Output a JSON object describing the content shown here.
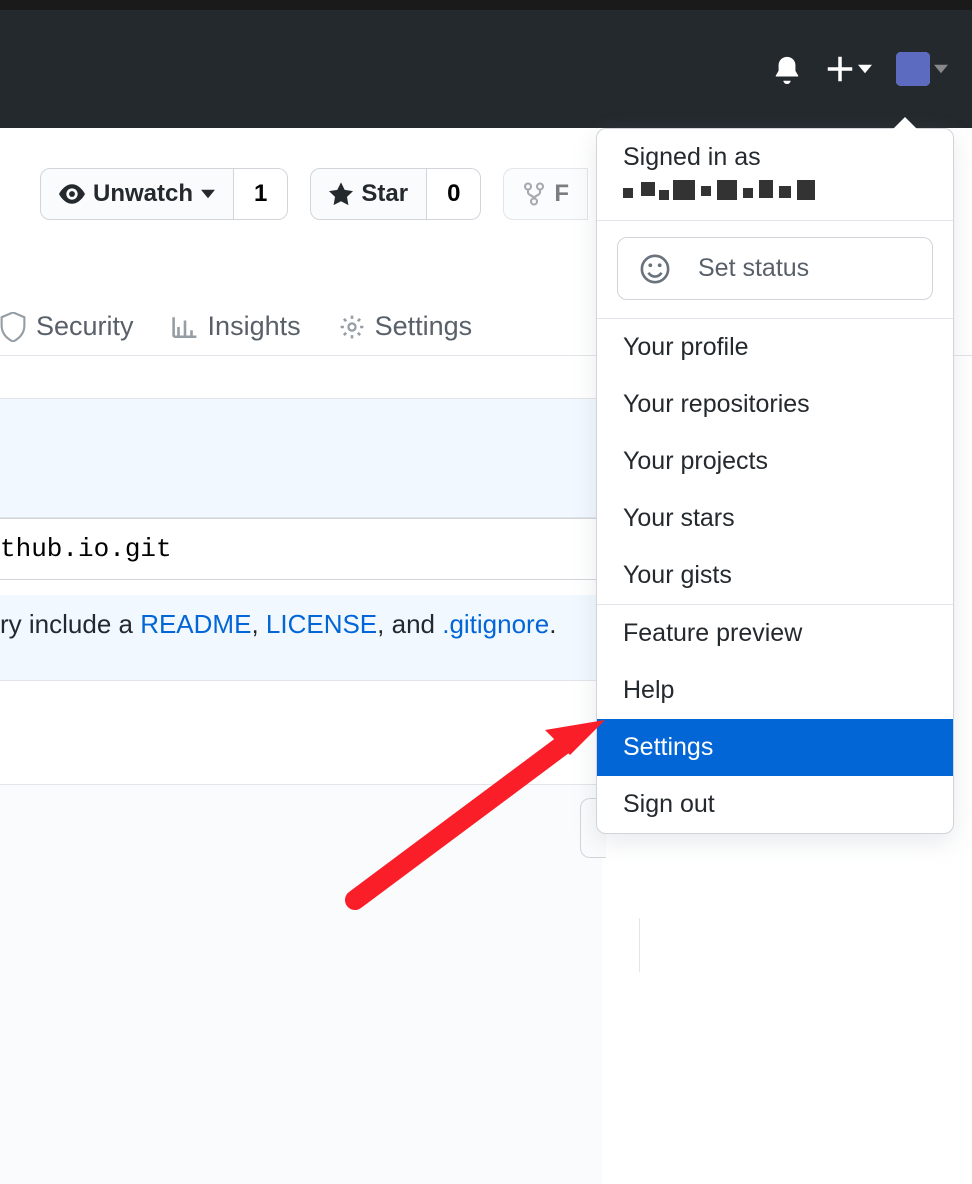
{
  "header": {
    "notifications_icon": "bell",
    "add_icon": "plus"
  },
  "repo_actions": {
    "watch": {
      "label": "Unwatch",
      "count": "1"
    },
    "star": {
      "label": "Star",
      "count": "0"
    },
    "fork": {
      "label": "F"
    }
  },
  "tabs": {
    "security": "Security",
    "insights": "Insights",
    "settings": "Settings"
  },
  "clone_url_fragment": "thub.io.git",
  "readme_line": {
    "prefix": "ry include a ",
    "readme": "README",
    "comma1": ", ",
    "license": "LICENSE",
    "comma2": ", and ",
    "gitignore": ".gitignore",
    "suffix": "."
  },
  "dropdown": {
    "signed_in_as": "Signed in as",
    "set_status": "Set status",
    "items": {
      "profile": "Your profile",
      "repos": "Your repositories",
      "projects": "Your projects",
      "stars": "Your stars",
      "gists": "Your gists",
      "feature": "Feature preview",
      "help": "Help",
      "settings": "Settings",
      "signout": "Sign out"
    }
  }
}
